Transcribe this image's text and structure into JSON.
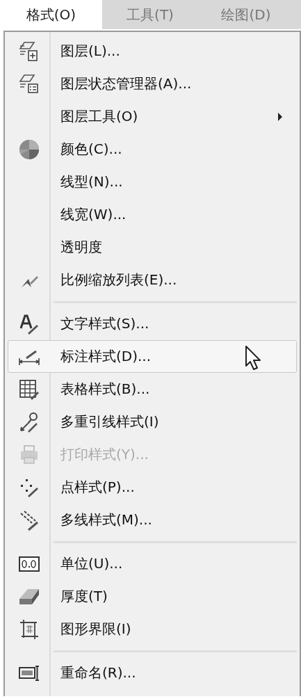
{
  "menubar": [
    {
      "label": "格式(O)",
      "selected": true
    },
    {
      "label": "工具(T)",
      "selected": false
    },
    {
      "label": "绘图(D)",
      "selected": false
    }
  ],
  "menu": {
    "sections": [
      [
        {
          "label": "图层(L)...",
          "disabled": false,
          "highlighted": false,
          "submenu": false
        },
        {
          "label": "图层状态管理器(A)...",
          "disabled": false,
          "highlighted": false,
          "submenu": false
        },
        {
          "label": "图层工具(O)",
          "disabled": false,
          "highlighted": false,
          "submenu": true
        },
        {
          "label": "颜色(C)...",
          "disabled": false,
          "highlighted": false,
          "submenu": false
        },
        {
          "label": "线型(N)...",
          "disabled": false,
          "highlighted": false,
          "submenu": false
        },
        {
          "label": "线宽(W)...",
          "disabled": false,
          "highlighted": false,
          "submenu": false
        },
        {
          "label": "透明度",
          "disabled": false,
          "highlighted": false,
          "submenu": false
        },
        {
          "label": "比例缩放列表(E)...",
          "disabled": false,
          "highlighted": false,
          "submenu": false
        }
      ],
      [
        {
          "label": "文字样式(S)...",
          "disabled": false,
          "highlighted": false,
          "submenu": false
        },
        {
          "label": "标注样式(D)...",
          "disabled": false,
          "highlighted": true,
          "submenu": false
        },
        {
          "label": "表格样式(B)...",
          "disabled": false,
          "highlighted": false,
          "submenu": false
        },
        {
          "label": "多重引线样式(I)",
          "disabled": false,
          "highlighted": false,
          "submenu": false
        },
        {
          "label": "打印样式(Y)...",
          "disabled": true,
          "highlighted": false,
          "submenu": false
        },
        {
          "label": "点样式(P)...",
          "disabled": false,
          "highlighted": false,
          "submenu": false
        },
        {
          "label": "多线样式(M)...",
          "disabled": false,
          "highlighted": false,
          "submenu": false
        }
      ],
      [
        {
          "label": "单位(U)...",
          "disabled": false,
          "highlighted": false,
          "submenu": false
        },
        {
          "label": "厚度(T)",
          "disabled": false,
          "highlighted": false,
          "submenu": false
        },
        {
          "label": "图形界限(I)",
          "disabled": false,
          "highlighted": false,
          "submenu": false
        }
      ],
      [
        {
          "label": "重命名(R)...",
          "disabled": false,
          "highlighted": false,
          "submenu": false
        }
      ]
    ]
  }
}
